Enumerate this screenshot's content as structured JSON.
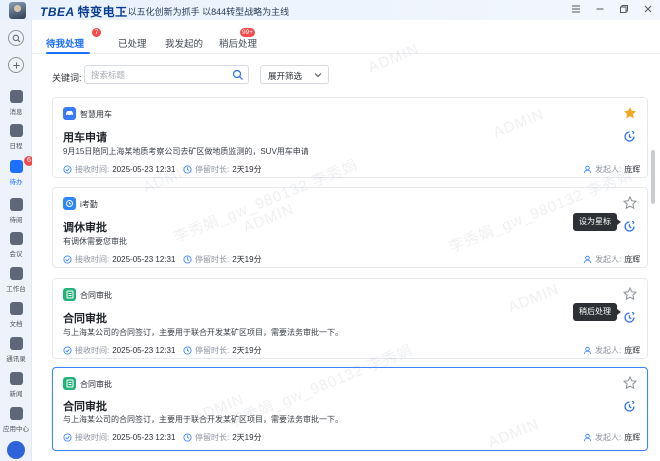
{
  "titlebar": {
    "logo_en": "TBEA",
    "logo_cn": "特变电工",
    "slogan": "• 以五化创新为抓手 以844转型战略为主线",
    "controls": [
      "menu-icon",
      "minimize-icon",
      "restore-icon",
      "close-icon"
    ]
  },
  "leftnav": {
    "items": [
      {
        "label": "消息",
        "icon": "message-icon"
      },
      {
        "label": "日程",
        "icon": "calendar-icon"
      },
      {
        "label": "待办",
        "icon": "todo-icon",
        "badge": "6",
        "active": true
      },
      {
        "label": "待阅",
        "icon": "read-icon"
      },
      {
        "label": "会议",
        "icon": "meeting-icon"
      },
      {
        "label": "工作台",
        "icon": "workbench-icon"
      },
      {
        "label": "文档",
        "icon": "document-icon"
      },
      {
        "label": "通讯录",
        "icon": "contacts-icon"
      },
      {
        "label": "新闻",
        "icon": "news-icon"
      },
      {
        "label": "应用中心",
        "icon": "app-center-icon"
      }
    ]
  },
  "tabs": [
    {
      "label": "待我处理",
      "badge": "7",
      "active": true
    },
    {
      "label": "已处理"
    },
    {
      "label": "我发起的"
    },
    {
      "label": "稍后处理",
      "badge": "99+"
    }
  ],
  "filter": {
    "keyword_label": "关键词:",
    "search_placeholder": "搜索标题",
    "select_value": "展开筛选"
  },
  "meta_labels": {
    "received": "接收时间:",
    "stay": "停留时长:",
    "initiator": "发起人:"
  },
  "cards": [
    {
      "app": "智慧用车",
      "app_icon": "car-icon",
      "app_color": "#3b7cf6",
      "title": "用车申请",
      "desc": "9月15日陪同上海某地质考察公司去矿区做地质监测的，SUV用车申请",
      "received": "2025-05-23  12:31",
      "stay": "2天19分",
      "initiator": "庞辉",
      "starred": true,
      "tooltip": ""
    },
    {
      "app": "i考勤",
      "app_icon": "attendance-icon",
      "app_color": "#2e86ff",
      "title": "调休审批",
      "desc": "有调休需要您审批",
      "received": "2025-05-23  12:31",
      "stay": "2天19分",
      "initiator": "庞辉",
      "starred": false,
      "tooltip": "设为星标"
    },
    {
      "app": "合同审批",
      "app_icon": "contract-icon",
      "app_color": "#23b27a",
      "title": "合同审批",
      "desc": "与上海某公司的合同签订，主要用于联合开发某矿区项目，需要法务审批一下。",
      "received": "2025-05-23  12:31",
      "stay": "2天19分",
      "initiator": "庞辉",
      "starred": false,
      "tooltip": "稍后处理"
    },
    {
      "app": "合同审批",
      "app_icon": "contract-icon",
      "app_color": "#23b27a",
      "title": "合同审批",
      "desc": "与上海某公司的合同签订，主要用于联合开发某矿区项目，需要法务审批一下。",
      "received": "2025-05-23  12:31",
      "stay": "2天19分",
      "initiator": "庞辉",
      "starred": false,
      "tooltip": ""
    }
  ],
  "watermark": {
    "admin": "ADMIN",
    "user": "李秀娟_gw_980132 李秀娟"
  },
  "colors": {
    "accent": "#1f6fff",
    "badge": "#f24b4b",
    "star": "#f5a623",
    "highlight_border": "#3d86ff"
  }
}
